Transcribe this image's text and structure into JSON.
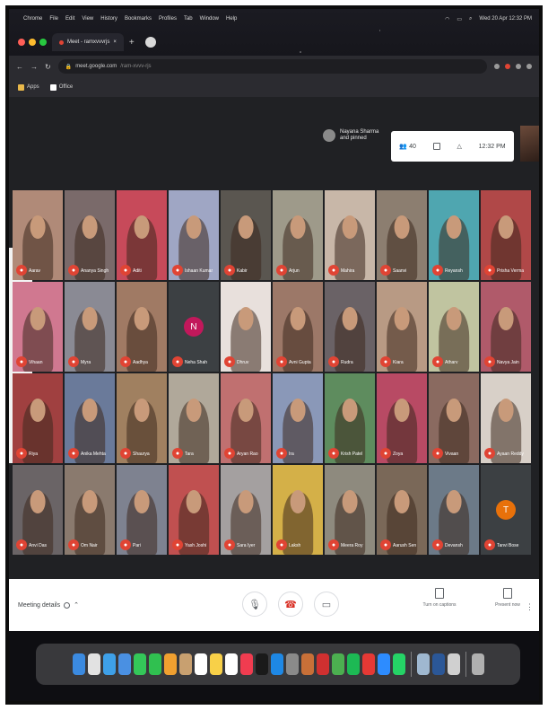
{
  "menubar": {
    "items": [
      "Chrome",
      "File",
      "Edit",
      "View",
      "History",
      "Bookmarks",
      "Profiles",
      "Tab",
      "Window",
      "Help"
    ],
    "datetime": "Wed 20 Apr 12:32 PM"
  },
  "browser": {
    "tab_title": "Meet - ramxvvvrjs",
    "new_tab_symbol": "+",
    "url": "meet.google.com",
    "url_rest": "/ram-xvvv-rjs",
    "bookmarks": [
      "Apps",
      "Office"
    ]
  },
  "meet": {
    "presenter_name": "Nayana Sharma",
    "presenter_sub": "and pinned",
    "toolbar": {
      "people_count": "40",
      "time": "12:32 PM"
    },
    "colors": {
      "mic_off": "#e04434",
      "tile_dark": "#3c4043"
    },
    "participants": [
      {
        "name": "Aarav",
        "bg": "#b08a78"
      },
      {
        "name": "Ananya Singh",
        "bg": "#7a6a6a"
      },
      {
        "name": "Aditi",
        "bg": "#c74a5a"
      },
      {
        "name": "Ishaan Kumar",
        "bg": "#9fa6c4"
      },
      {
        "name": "Kabir",
        "bg": "#5a5650"
      },
      {
        "name": "Arjun",
        "bg": "#9e9a8a"
      },
      {
        "name": "Mahira",
        "bg": "#c8b7a8"
      },
      {
        "name": "Saanvi",
        "bg": "#8c7e70"
      },
      {
        "name": "Reyansh",
        "bg": "#4fa6b0"
      },
      {
        "name": "Prisha Verma",
        "bg": "#b04848"
      },
      {
        "name": "Vihaan",
        "bg": "#d07890"
      },
      {
        "name": "Myra",
        "bg": "#8a8a94"
      },
      {
        "name": "Aadhya",
        "bg": "#a07a64"
      },
      {
        "name": "Neha Shah",
        "bg": "#3c4043",
        "initial": "N",
        "initial_bg": "#c2185b"
      },
      {
        "name": "Dhruv",
        "bg": "#e8e0dc"
      },
      {
        "name": "Avni Gupta",
        "bg": "#9c7868"
      },
      {
        "name": "Rudra",
        "bg": "#6a6266"
      },
      {
        "name": "Kiara",
        "bg": "#b89a84"
      },
      {
        "name": "Atharv",
        "bg": "#c0c4a0"
      },
      {
        "name": "Navya Jain",
        "bg": "#b05a6a"
      },
      {
        "name": "Riya",
        "bg": "#a04040"
      },
      {
        "name": "Anika Mehta",
        "bg": "#6a7a9a"
      },
      {
        "name": "Shaurya",
        "bg": "#a08060"
      },
      {
        "name": "Tara",
        "bg": "#b0a89a"
      },
      {
        "name": "Aryan Rao",
        "bg": "#c07070"
      },
      {
        "name": "Ira",
        "bg": "#8a98b8"
      },
      {
        "name": "Krish Patel",
        "bg": "#5e8c5e"
      },
      {
        "name": "Zoya",
        "bg": "#b84a64"
      },
      {
        "name": "Vivaan",
        "bg": "#8a6a60"
      },
      {
        "name": "Ayaan Reddy",
        "bg": "#d8d0c8"
      },
      {
        "name": "Anvi Das",
        "bg": "#6a6466"
      },
      {
        "name": "Om Nair",
        "bg": "#8a7a6e"
      },
      {
        "name": "Pari",
        "bg": "#7e8290"
      },
      {
        "name": "Yash Joshi",
        "bg": "#c05050"
      },
      {
        "name": "Sara Iyer",
        "bg": "#a4a0a0"
      },
      {
        "name": "Laksh",
        "bg": "#d4b048"
      },
      {
        "name": "Meera Roy",
        "bg": "#8e8a7e"
      },
      {
        "name": "Aarush Sen",
        "bg": "#7a6858"
      },
      {
        "name": "Devansh",
        "bg": "#6c7a88"
      },
      {
        "name": "Tanvi Bose",
        "bg": "#3c4043",
        "initial": "T",
        "initial_bg": "#e8710a"
      }
    ]
  },
  "bottombar": {
    "meeting_details": "Meeting details",
    "turn_on_captions": "Turn on captions",
    "present_now": "Present now",
    "more_options": "⋮"
  },
  "dock": {
    "apps": [
      {
        "name": "finder",
        "color": "#3b8ae0"
      },
      {
        "name": "launchpad",
        "color": "#e2e2e2"
      },
      {
        "name": "safari",
        "color": "#3ea0e8"
      },
      {
        "name": "mail",
        "color": "#4a90e2"
      },
      {
        "name": "facetime",
        "color": "#34c759"
      },
      {
        "name": "messages",
        "color": "#30c050"
      },
      {
        "name": "photos",
        "color": "#f0a030"
      },
      {
        "name": "contacts",
        "color": "#c8a070"
      },
      {
        "name": "calendar",
        "color": "#ffffff"
      },
      {
        "name": "notes",
        "color": "#f8d048"
      },
      {
        "name": "reminders",
        "color": "#ffffff"
      },
      {
        "name": "music",
        "color": "#f03c50"
      },
      {
        "name": "tv",
        "color": "#1a1a1a"
      },
      {
        "name": "app-store",
        "color": "#1e88e5"
      },
      {
        "name": "system-preferences",
        "color": "#8a8a8a"
      },
      {
        "name": "guitar",
        "color": "#c87038"
      },
      {
        "name": "photo-booth",
        "color": "#d03030"
      },
      {
        "name": "chrome",
        "color": "#4caf50"
      },
      {
        "name": "spotify",
        "color": "#1db954"
      },
      {
        "name": "zoom-red",
        "color": "#e53935"
      },
      {
        "name": "zoom",
        "color": "#2d8cff"
      },
      {
        "name": "whatsapp",
        "color": "#25d366"
      },
      {
        "name": "preview",
        "color": "#9fb8d0"
      },
      {
        "name": "word",
        "color": "#2b5797"
      },
      {
        "name": "notes-list",
        "color": "#d0d0d0"
      },
      {
        "name": "trash",
        "color": "#b0b0b0"
      }
    ]
  }
}
